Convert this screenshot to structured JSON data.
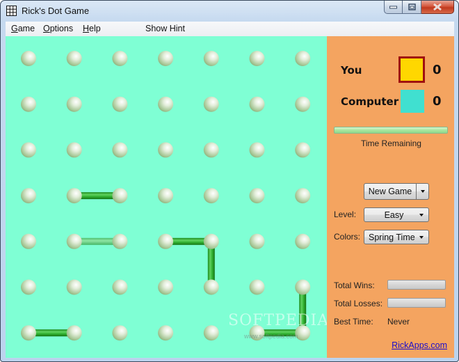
{
  "window": {
    "title": "Rick's Dot Game",
    "icon": "grid-icon",
    "controls": [
      "minimize",
      "maximize",
      "close"
    ]
  },
  "menu": {
    "items": [
      {
        "label": "Game",
        "mnemonic": "G",
        "rest": "ame"
      },
      {
        "label": "Options",
        "mnemonic": "O",
        "rest": "ptions"
      },
      {
        "label": "Help",
        "mnemonic": "H",
        "rest": "elp"
      }
    ],
    "show_hint": "Show Hint"
  },
  "board": {
    "rows": 7,
    "cols": 7,
    "background": "#7fffd4",
    "dot_color": "#c9dfb8",
    "line_color": "#2eaa2e",
    "hint_line_color": "#66d08a",
    "lines": [
      {
        "from": [
          3,
          4
        ],
        "to": [
          4,
          4
        ],
        "kind": "played"
      },
      {
        "from": [
          1,
          3
        ],
        "to": [
          2,
          3
        ],
        "kind": "played"
      },
      {
        "from": [
          1,
          4
        ],
        "to": [
          2,
          4
        ],
        "kind": "faded"
      },
      {
        "from": [
          4,
          4
        ],
        "to": [
          4,
          5
        ],
        "kind": "played"
      },
      {
        "from": [
          6,
          5
        ],
        "to": [
          6,
          6
        ],
        "kind": "played"
      },
      {
        "from": [
          5,
          6
        ],
        "to": [
          6,
          6
        ],
        "kind": "played"
      },
      {
        "from": [
          0,
          6
        ],
        "to": [
          1,
          6
        ],
        "kind": "played"
      }
    ],
    "watermark": "SOFTPEDIA",
    "watermark_sub": "www.softpedia.com"
  },
  "scoreboard": {
    "you": {
      "label": "You",
      "score": "0",
      "color": "#ffd700",
      "border": "#a01010"
    },
    "computer": {
      "label": "Computer",
      "score": "0",
      "color": "#40e0d0"
    },
    "time_label": "Time Remaining",
    "time_remaining_fraction": 1.0
  },
  "controls": {
    "new_game": "New Game",
    "level_label": "Level:",
    "level_value": "Easy",
    "colors_label": "Colors:",
    "colors_value": "Spring Time"
  },
  "stats": {
    "wins_label": "Total Wins:",
    "losses_label": "Total Losses:",
    "best_time_label": "Best Time:",
    "best_time_value": "Never"
  },
  "footer": {
    "link": "RickApps.com"
  }
}
